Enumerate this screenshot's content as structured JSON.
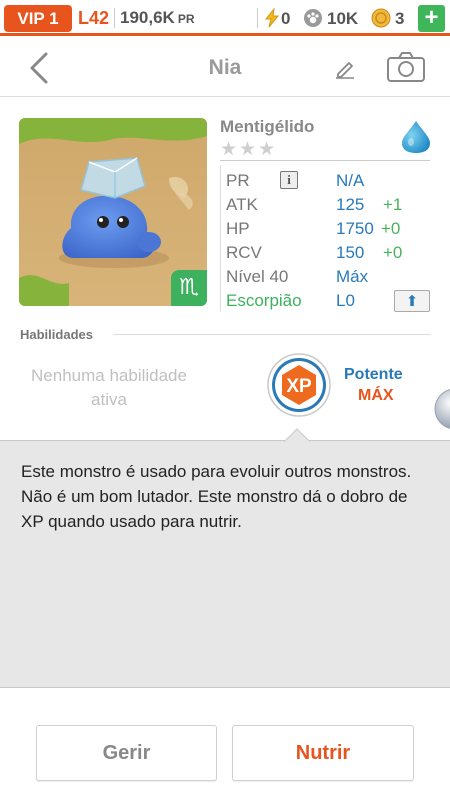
{
  "status": {
    "vip": "VIP 1",
    "level": "L42",
    "power_value": "190,6K",
    "power_unit": "PR",
    "energy": "0",
    "food": "10K",
    "coins": "3",
    "add": "+"
  },
  "nav": {
    "title": "Nia"
  },
  "monster": {
    "species": "Mentigélido",
    "stars": "★★★",
    "element_icon": "water-drop-icon",
    "zodiac_glyph": "♏",
    "stats": {
      "pr_label": "PR",
      "pr_value": "N/A",
      "atk_label": "ATK",
      "atk_value": "125",
      "atk_bonus": "+1",
      "hp_label": "HP",
      "hp_value": "1750",
      "hp_bonus": "+0",
      "rcv_label": "RCV",
      "rcv_value": "150",
      "rcv_bonus": "+0",
      "level_label": "Nível 40",
      "level_value": "Máx",
      "zodiac_label": "Escorpião",
      "zodiac_value": "L0"
    },
    "info_glyph": "i",
    "upgrade_glyph": "⬆"
  },
  "abilities": {
    "heading": "Habilidades",
    "none_text": "Nenhuma habilidade ativa",
    "badge_text": "XP",
    "trait_name": "Potente",
    "trait_level": "MÁX"
  },
  "description": "Este monstro é usado para evoluir outros monstros. Não é um bom lutador. Este monstro dá o dobro de XP quando usado para nutrir.",
  "buttons": {
    "manage": "Gerir",
    "feed": "Nutrir"
  },
  "colors": {
    "accent": "#e8541e",
    "stat_blue": "#2a7ab8",
    "bonus_green": "#49b35c",
    "zodiac_green": "#3db15e"
  }
}
